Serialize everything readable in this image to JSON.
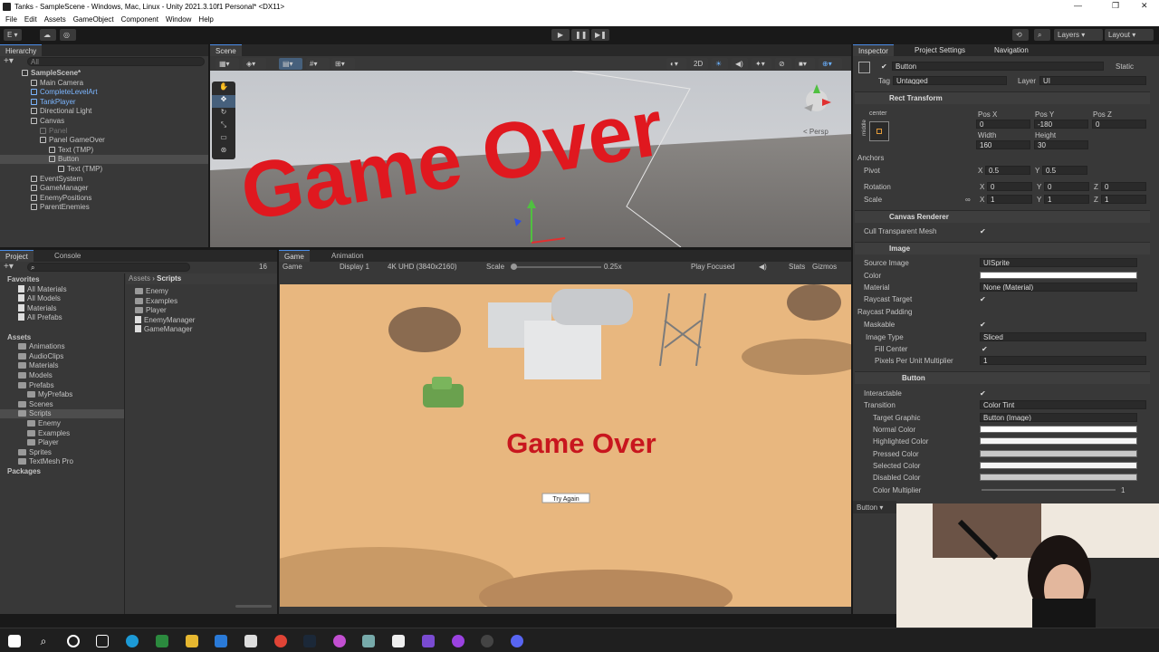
{
  "window": {
    "title": "Tanks - SampleScene - Windows, Mac, Linux - Unity 2021.3.10f1 Personal* <DX11>",
    "minimize": "—",
    "maximize": "❐",
    "close": "✕"
  },
  "menu": [
    "File",
    "Edit",
    "Assets",
    "GameObject",
    "Component",
    "Window",
    "Help"
  ],
  "toolbar": {
    "account": "E ▾",
    "layers": "Layers",
    "layout": "Layout"
  },
  "hierarchy": {
    "tab": "Hierarchy",
    "search_placeholder": "All",
    "items": [
      {
        "label": "SampleScene*",
        "depth": 0,
        "kind": "scene"
      },
      {
        "label": "Main Camera",
        "depth": 1,
        "kind": "obj"
      },
      {
        "label": "CompleteLevelArt",
        "depth": 1,
        "kind": "prefab"
      },
      {
        "label": "TankPlayer",
        "depth": 1,
        "kind": "prefab"
      },
      {
        "label": "Directional Light",
        "depth": 1,
        "kind": "obj"
      },
      {
        "label": "Canvas",
        "depth": 1,
        "kind": "obj"
      },
      {
        "label": "Panel",
        "depth": 2,
        "kind": "disabled"
      },
      {
        "label": "Panel GameOver",
        "depth": 2,
        "kind": "obj"
      },
      {
        "label": "Text (TMP)",
        "depth": 3,
        "kind": "obj"
      },
      {
        "label": "Button",
        "depth": 3,
        "kind": "selected"
      },
      {
        "label": "Text (TMP)",
        "depth": 4,
        "kind": "obj"
      },
      {
        "label": "EventSystem",
        "depth": 1,
        "kind": "obj"
      },
      {
        "label": "GameManager",
        "depth": 1,
        "kind": "obj"
      },
      {
        "label": "EnemyPositions",
        "depth": 1,
        "kind": "obj"
      },
      {
        "label": "ParentEnemies",
        "depth": 1,
        "kind": "obj"
      }
    ]
  },
  "scene": {
    "tab": "Scene",
    "persp": "< Persp",
    "text": "Game Over",
    "mode_2d": "2D"
  },
  "project": {
    "tab": "Project",
    "console_tab": "Console",
    "count": "16",
    "favorites_label": "Favorites",
    "favorites": [
      "All Materials",
      "All Models",
      "Materials",
      "All Prefabs"
    ],
    "assets_label": "Assets",
    "assets": [
      {
        "label": "Animations",
        "depth": 1
      },
      {
        "label": "AudioClips",
        "depth": 1
      },
      {
        "label": "Materials",
        "depth": 1
      },
      {
        "label": "Models",
        "depth": 1
      },
      {
        "label": "Prefabs",
        "depth": 1
      },
      {
        "label": "MyPrefabs",
        "depth": 2
      },
      {
        "label": "Scenes",
        "depth": 1
      },
      {
        "label": "Scripts",
        "depth": 1
      },
      {
        "label": "Enemy",
        "depth": 2
      },
      {
        "label": "Examples",
        "depth": 2
      },
      {
        "label": "Player",
        "depth": 2
      },
      {
        "label": "Sprites",
        "depth": 1
      },
      {
        "label": "TextMesh Pro",
        "depth": 1
      }
    ],
    "packages_label": "Packages",
    "breadcrumb": [
      "Assets",
      "Scripts"
    ],
    "files": [
      {
        "label": "Enemy",
        "kind": "folder"
      },
      {
        "label": "Examples",
        "kind": "folder"
      },
      {
        "label": "Player",
        "kind": "folder"
      },
      {
        "label": "EnemyManager",
        "kind": "script"
      },
      {
        "label": "GameManager",
        "kind": "script"
      }
    ]
  },
  "game": {
    "tab": "Game",
    "animation_tab": "Animation",
    "mode": "Game",
    "display": "Display 1",
    "resolution": "4K UHD (3840x2160)",
    "scale_label": "Scale",
    "scale_value": "0.25x",
    "play_focused": "Play Focused",
    "stats": "Stats",
    "gizmos": "Gizmos",
    "game_over": "Game Over",
    "try_again": "Try Again"
  },
  "inspector": {
    "tab": "Inspector",
    "project_settings_tab": "Project Settings",
    "navigation_tab": "Navigation",
    "object_name": "Button",
    "static": "Static",
    "tag_label": "Tag",
    "tag_value": "Untagged",
    "layer_label": "Layer",
    "layer_value": "UI",
    "rect": {
      "header": "Rect Transform",
      "anchor_label": "center",
      "side_label": "middle",
      "posx_label": "Pos X",
      "posy_label": "Pos Y",
      "posz_label": "Pos Z",
      "posx": "0",
      "posy": "-180",
      "posz": "0",
      "width_label": "Width",
      "height_label": "Height",
      "width": "160",
      "height": "30",
      "anchors": "Anchors",
      "pivot": "Pivot",
      "pivot_x": "0.5",
      "pivot_y": "0.5",
      "rotation": "Rotation",
      "rot_x": "0",
      "rot_y": "0",
      "rot_z": "0",
      "scale": "Scale",
      "scale_x": "1",
      "scale_y": "1",
      "scale_z": "1",
      "x": "X",
      "y": "Y",
      "z": "Z"
    },
    "canvas_renderer": {
      "header": "Canvas Renderer",
      "cull": "Cull Transparent Mesh"
    },
    "image": {
      "header": "Image",
      "source_label": "Source Image",
      "source": "UISprite",
      "color_label": "Color",
      "material_label": "Material",
      "material": "None (Material)",
      "raycast_target": "Raycast Target",
      "raycast_padding": "Raycast Padding",
      "maskable": "Maskable",
      "image_type_label": "Image Type",
      "image_type": "Sliced",
      "fill_center": "Fill Center",
      "ppu_label": "Pixels Per Unit Multiplier",
      "ppu": "1"
    },
    "button": {
      "header": "Button",
      "interactable": "Interactable",
      "transition_label": "Transition",
      "transition": "Color Tint",
      "target_label": "Target Graphic",
      "target": "Button (Image)",
      "normal": "Normal Color",
      "highlighted": "Highlighted Color",
      "pressed": "Pressed Color",
      "selected": "Selected Color",
      "disabled": "Disabled Color",
      "multiplier": "Color Multiplier",
      "multiplier_value": "1"
    },
    "footer": "Button ▾"
  },
  "colors": {
    "accent": "#4a8de8",
    "game_over_red": "#c8161e",
    "sand": "#e8b77f",
    "panel": "#383838"
  }
}
